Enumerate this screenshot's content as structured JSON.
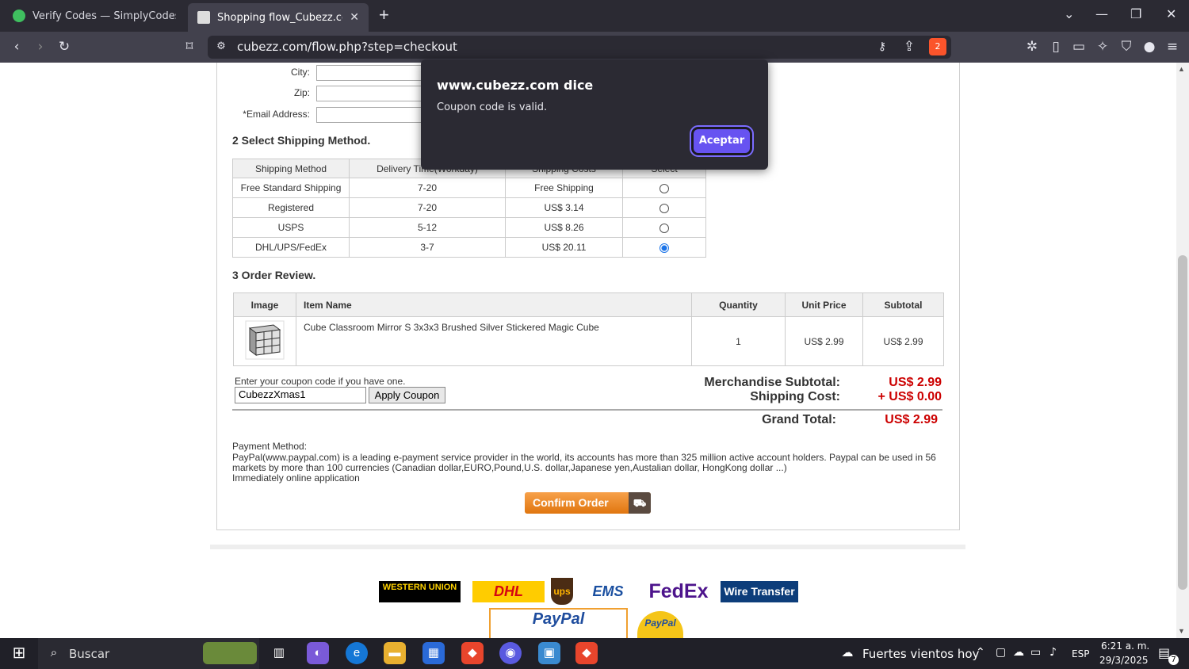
{
  "browser": {
    "tabs": [
      {
        "title": "Verify Codes — SimplyCodes",
        "active": false
      },
      {
        "title": "Shopping flow_Cubezz.com: Pr",
        "active": true
      }
    ],
    "url": "cubezz.com/flow.php?step=checkout",
    "brave_badge": "2"
  },
  "form": {
    "city_label": "City:",
    "zip_label": "Zip:",
    "email_label": "*Email Address:"
  },
  "shipping": {
    "heading": "2 Select Shipping Method.",
    "headers": [
      "Shipping Method",
      "Delivery Time(Workday)",
      "Shipping Costs",
      "Select"
    ],
    "rows": [
      {
        "method": "Free Standard Shipping",
        "time": "7-20",
        "cost": "Free Shipping",
        "selected": false
      },
      {
        "method": "Registered",
        "time": "7-20",
        "cost": "US$ 3.14",
        "selected": false
      },
      {
        "method": "USPS",
        "time": "5-12",
        "cost": "US$ 8.26",
        "selected": false
      },
      {
        "method": "DHL/UPS/FedEx",
        "time": "3-7",
        "cost": "US$ 20.11",
        "selected": true
      }
    ]
  },
  "order": {
    "heading": "3 Order Review.",
    "headers": [
      "Image",
      "Item Name",
      "Quantity",
      "Unit Price",
      "Subtotal"
    ],
    "item": {
      "name": "Cube Classroom Mirror S 3x3x3 Brushed Silver Stickered Magic Cube",
      "quantity": "1",
      "unit_price": "US$ 2.99",
      "subtotal": "US$ 2.99"
    }
  },
  "coupon": {
    "prompt": "Enter your coupon code if you have one.",
    "value": "CubezzXmas1",
    "button": "Apply Coupon"
  },
  "totals": {
    "merch_label": "Merchandise Subtotal:",
    "merch_value": "US$ 2.99",
    "shipping_label": "Shipping Cost:",
    "shipping_value": "+ US$ 0.00",
    "grand_label": "Grand Total:",
    "grand_value": "US$ 2.99"
  },
  "payment": {
    "label": "Payment Method:",
    "description": "PayPal(www.paypal.com) is a leading e-payment service provider in the world, its accounts has more than 325 million active account holders. Paypal can be used in 56 markets by more than 100 currencies (Canadian dollar,EURO,Pound,U.S. dollar,Japanese yen,Austalian dollar, HongKong dollar ...)",
    "note": "Immediately online application",
    "confirm_button": "Confirm Order"
  },
  "footer_logos": {
    "western_union": "WESTERN UNION",
    "dhl": "DHL",
    "ups": "ups",
    "ems": "EMS",
    "fedex": "FedEx",
    "wire": "Wire Transfer",
    "paypal": "PayPal",
    "paypal_badge": "PayPal"
  },
  "dialog": {
    "title": "www.cubezz.com dice",
    "message": "Coupon code is valid.",
    "button": "Aceptar"
  },
  "taskbar": {
    "search": "Buscar",
    "weather": "Fuertes vientos hoy",
    "lang": "ESP",
    "time": "6:21 a. m.",
    "date": "29/3/2025",
    "notifications": "7"
  },
  "colors": {
    "accent": "#6753f1",
    "price_red": "#cc0000",
    "confirm_orange": "#e0760f"
  }
}
